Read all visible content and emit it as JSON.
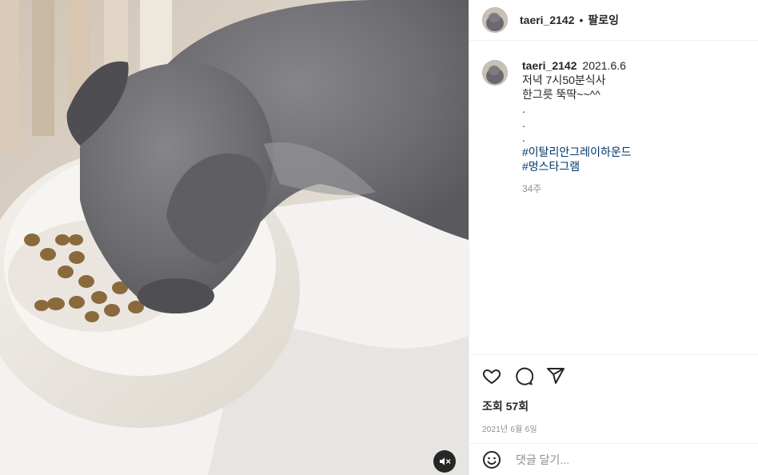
{
  "post": {
    "username": "taeri_2142",
    "separator": "•",
    "follow_label": "팔로잉",
    "caption": {
      "username": "taeri_2142",
      "date": "2021.6.6",
      "lines": [
        "저녁 7시50분식사",
        "한그릇 뚝딱~~^^",
        ".",
        ".",
        "."
      ],
      "hashtags": [
        "#이탈리안그레이하운드",
        "#멍스타그램"
      ],
      "age": "34주"
    },
    "views": "조회 57회",
    "posted_date": "2021년 6월 6일",
    "comment_placeholder": "댓글 달기..."
  },
  "icons": {
    "like": "heart-icon",
    "comment": "comment-icon",
    "share": "send-icon",
    "emoji": "emoji-icon",
    "mute": "muted-speaker-icon"
  },
  "colors": {
    "link": "#00376b",
    "muted_text": "#8e8e8e",
    "divider": "#efefef"
  }
}
